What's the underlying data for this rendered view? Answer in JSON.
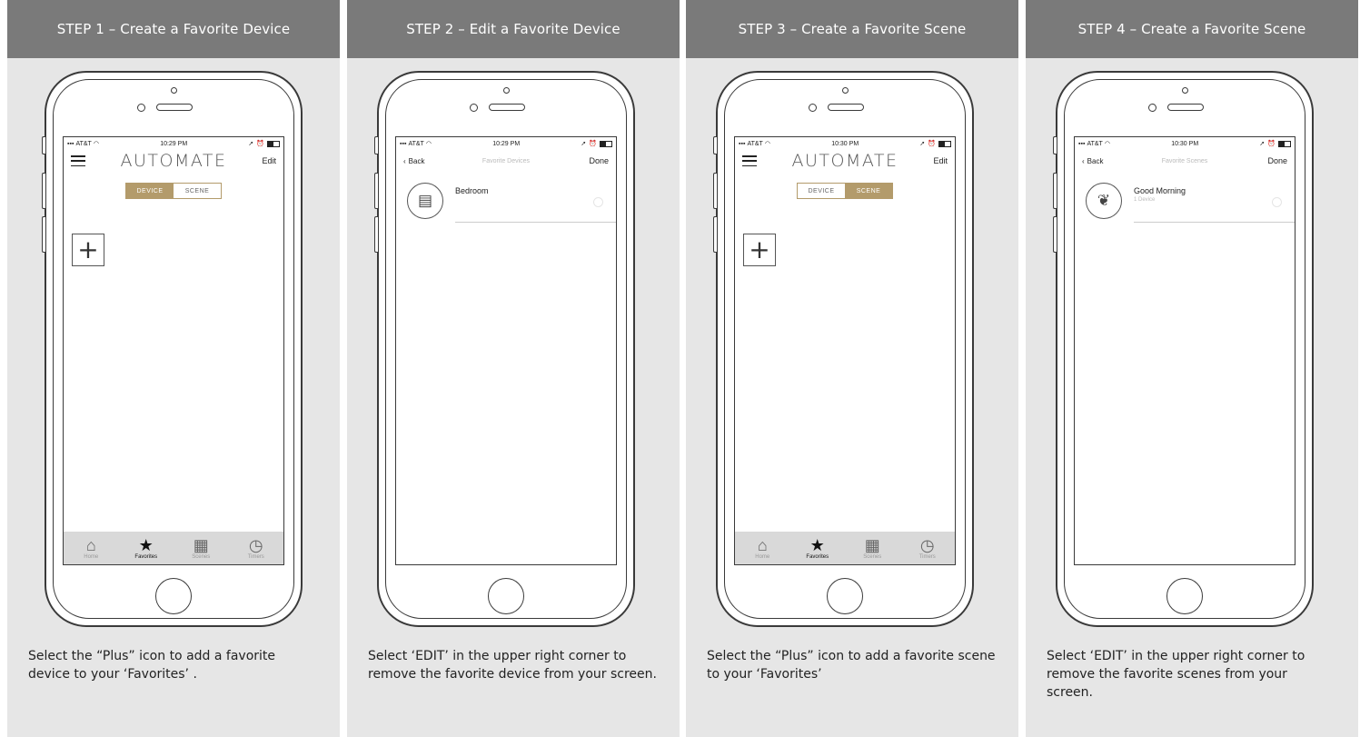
{
  "panels": [
    {
      "header": "STEP 1 – Create a Favorite Device",
      "caption": "Select the “Plus” icon to add a favorite device to your ‘Favorites’ .",
      "status": {
        "carrier": "AT&T",
        "time": "10:29 PM"
      },
      "nav": {
        "logo": "AUTOMATE",
        "right": "Edit"
      },
      "segment": {
        "device": "DEVICE",
        "scene": "SCENE",
        "active": "DEVICE"
      },
      "tabs": [
        "Home",
        "Favorites",
        "Scenes",
        "Timers"
      ],
      "active_tab": "Favorites"
    },
    {
      "header": "STEP 2 – Edit a Favorite Device",
      "caption": "Select ‘EDIT’ in the upper right corner to remove the favorite device from your screen.",
      "status": {
        "carrier": "AT&T",
        "time": "10:29 PM"
      },
      "nav": {
        "back": "Back",
        "title": "Favorite Devices",
        "right": "Done"
      },
      "item": {
        "label": "Bedroom",
        "icon": "shade-icon"
      }
    },
    {
      "header": "STEP 3 – Create a Favorite Scene",
      "caption": "Select the “Plus” icon to add a favorite scene to your ‘Favorites’",
      "status": {
        "carrier": "AT&T",
        "time": "10:30 PM"
      },
      "nav": {
        "logo": "AUTOMATE",
        "right": "Edit"
      },
      "segment": {
        "device": "DEVICE",
        "scene": "SCENE",
        "active": "SCENE"
      },
      "tabs": [
        "Home",
        "Favorites",
        "Scenes",
        "Timers"
      ],
      "active_tab": "Favorites"
    },
    {
      "header": "STEP 4 – Create a Favorite Scene",
      "caption": "Select ‘EDIT’ in the upper right corner to remove the favorite scenes from your screen.",
      "status": {
        "carrier": "AT&T",
        "time": "10:30 PM"
      },
      "nav": {
        "back": "Back",
        "title": "Favorite Scenes",
        "right": "Done"
      },
      "item": {
        "label": "Good Morning",
        "sublabel": "1 Device",
        "icon": "leaf-icon"
      }
    }
  ],
  "colors": {
    "header_bg": "#7a7a7a",
    "panel_bg": "#e6e6e6",
    "accent": "#b39b6b"
  }
}
